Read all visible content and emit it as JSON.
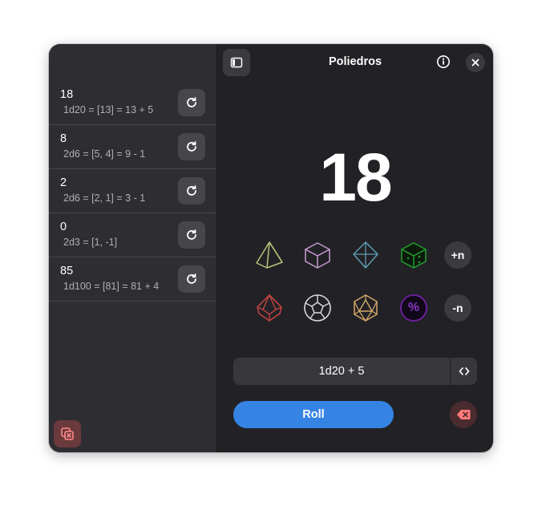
{
  "window": {
    "title": "Poliedros"
  },
  "header": {
    "info_icon": "info-icon",
    "close_icon": "close-icon",
    "sidebar_icon": "sidebar-toggle-icon"
  },
  "history": [
    {
      "result": "18",
      "detail": "1d20 = [13] = 13 + 5"
    },
    {
      "result": "8",
      "detail": "2d6 = [5, 4] = 9 - 1"
    },
    {
      "result": "2",
      "detail": "2d6 = [2, 1] = 3 - 1"
    },
    {
      "result": "0",
      "detail": "2d3 = [1, -1]"
    },
    {
      "result": "85",
      "detail": "1d100 = [81] = 81 + 4"
    }
  ],
  "main": {
    "result": "18",
    "modifiers": {
      "plus": "+n",
      "minus": "-n"
    },
    "dice": {
      "percentile_glyph": "%",
      "colors": {
        "d4": "#b8c27a",
        "d6": "#c69bd0",
        "d8": "#5d9cb0",
        "d6_green": "#22a02c",
        "d10": "#c94343",
        "d12": "#d9d9d9",
        "d20": "#d4a86a",
        "d100": "#6a1f9a"
      }
    },
    "formula": {
      "value": "1d20 + 5"
    },
    "roll_label": "Roll"
  },
  "colors": {
    "accent": "#3584e4",
    "destructive": "#ff7b7b",
    "window_bg": "#222226",
    "sidebar_bg": "#2e2e32"
  }
}
